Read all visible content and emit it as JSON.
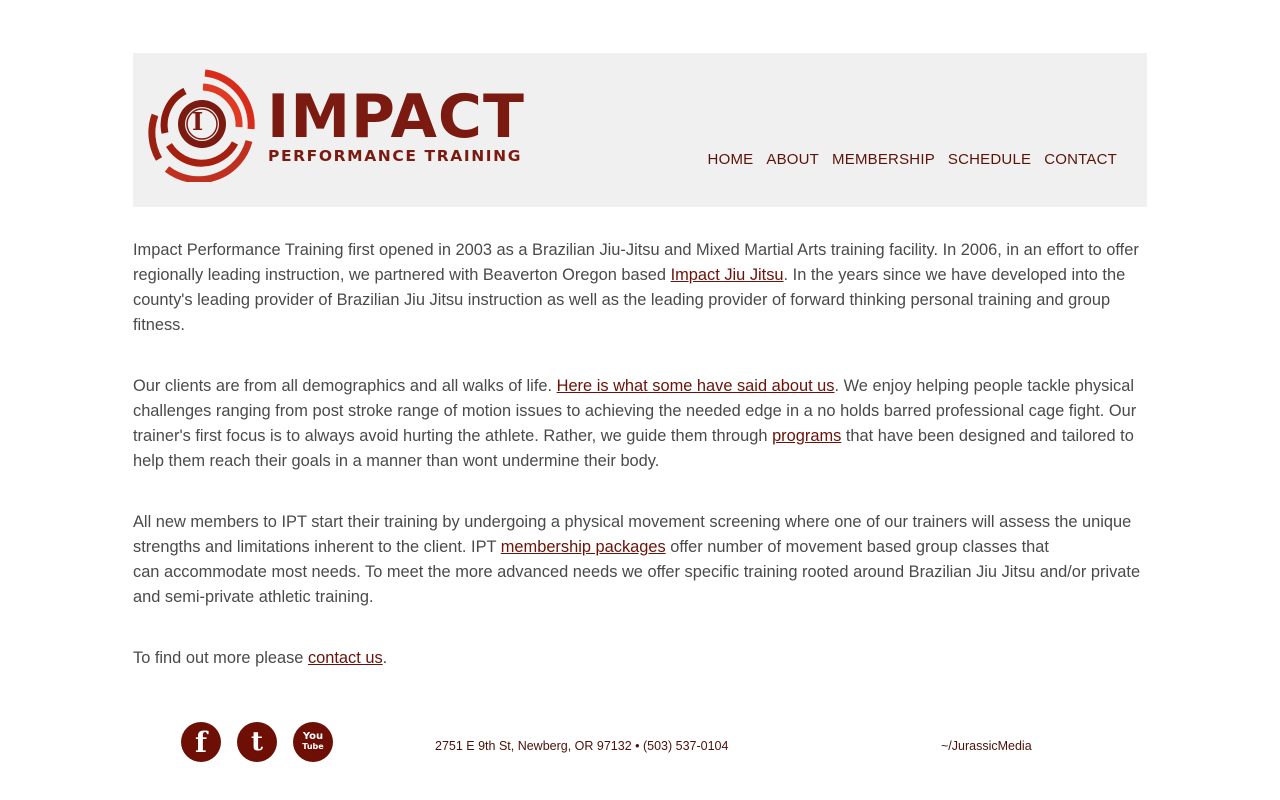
{
  "logo": {
    "title": "IMPACT",
    "subtitle": "PERFORMANCE TRAINING",
    "mark_letter": "I"
  },
  "nav": {
    "items": [
      "HOME",
      "ABOUT",
      "MEMBERSHIP",
      "SCHEDULE",
      "CONTACT"
    ]
  },
  "content": {
    "p1": {
      "text_a": "Impact Performance Training first opened in 2003 as a Brazilian Jiu-Jitsu and Mixed Martial Arts training facility. In 2006, in an effort to offer regionally leading instruction, we partnered with Beaverton Oregon based ",
      "link": "Impact Jiu Jitsu",
      "text_b": ".  In the years since we have developed into the county's leading provider of Brazilian Jiu Jitsu instruction as well as the leading provider of forward thinking personal training and group fitness."
    },
    "p2": {
      "text_a": "Our clients are from all demographics and all walks of life. ",
      "link1": "Here is what some have said about us",
      "text_b": ".  We enjoy helping people tackle physical challenges ranging from post stroke range of motion issues to achieving the needed edge in a no holds barred professional cage fight. Our trainer's first focus is to always avoid hurting the athlete. Rather, we guide them through ",
      "link2": "programs",
      "text_c": " that have been designed and tailored to help them reach their goals in a manner than wont undermine their body."
    },
    "p3": {
      "text_a": "All new members to IPT start their training by undergoing a physical movement screening where one of our trainers will assess the unique strengths and limitations inherent to the client. IPT ",
      "link": "membership packages",
      "text_b": " offer number of movement based group classes that",
      "text_c": "can accommodate most needs. To meet the more advanced needs we offer specific training rooted around Brazilian Jiu Jitsu and/or private and semi-private athletic training."
    },
    "p4": {
      "text_a": "To find out more please ",
      "link": "contact us",
      "text_b": "."
    }
  },
  "footer": {
    "social": {
      "facebook": "f",
      "twitter": "t",
      "youtube_top": "You",
      "youtube_bottom": "Tube"
    },
    "address": "2751 E 9th St, Newberg, OR 97132 • (503) 537-0104",
    "credit": "~/JurassicMedia"
  },
  "colors": {
    "brand": "#7a1a10",
    "brand_bright": "#d92b1a",
    "header_bg": "#f0f0f0",
    "link": "#6a1208",
    "social_bg": "#6e0f06"
  },
  "icons": [
    "logo-ring-mark",
    "facebook-icon",
    "twitter-icon",
    "youtube-icon"
  ]
}
